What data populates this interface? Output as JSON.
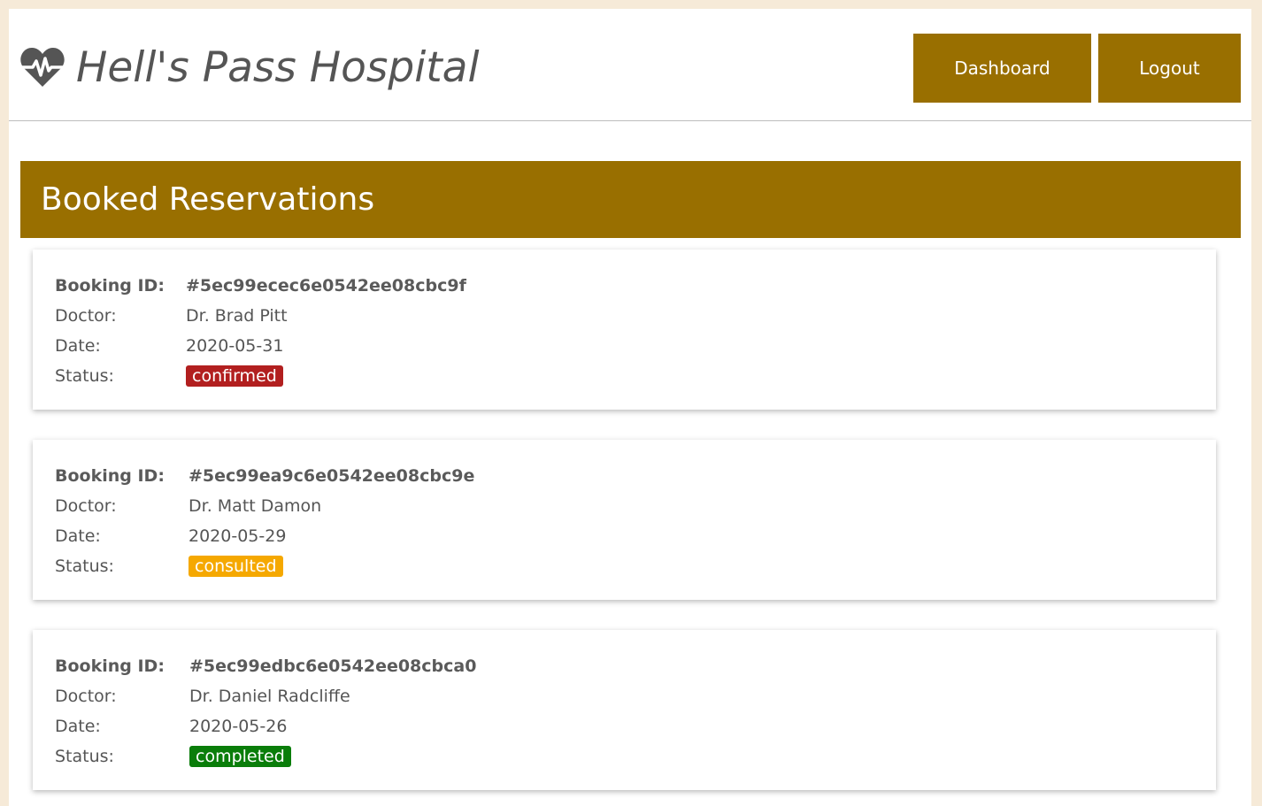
{
  "app": {
    "title": "Hell's Pass Hospital",
    "logo_icon": "heartbeat-icon",
    "brand_color": "#996f00"
  },
  "nav": {
    "dashboard_label": "Dashboard",
    "logout_label": "Logout"
  },
  "main": {
    "heading": "Booked Reservations",
    "labels": {
      "booking_id": "Booking ID:",
      "doctor": "Doctor:",
      "date": "Date:",
      "status": "Status:"
    },
    "reservations": [
      {
        "booking_id": "#5ec99ecec6e0542ee08cbc9f",
        "doctor": "Dr. Brad Pitt",
        "date": "2020-05-31",
        "status": "confirmed",
        "status_color": "#b21f1f"
      },
      {
        "booking_id": "#5ec99ea9c6e0542ee08cbc9e",
        "doctor": "Dr. Matt Damon",
        "date": "2020-05-29",
        "status": "consulted",
        "status_color": "#f5a800"
      },
      {
        "booking_id": "#5ec99edbc6e0542ee08cbca0",
        "doctor": "Dr. Daniel Radcliffe",
        "date": "2020-05-26",
        "status": "completed",
        "status_color": "#0a7d0a"
      }
    ]
  }
}
